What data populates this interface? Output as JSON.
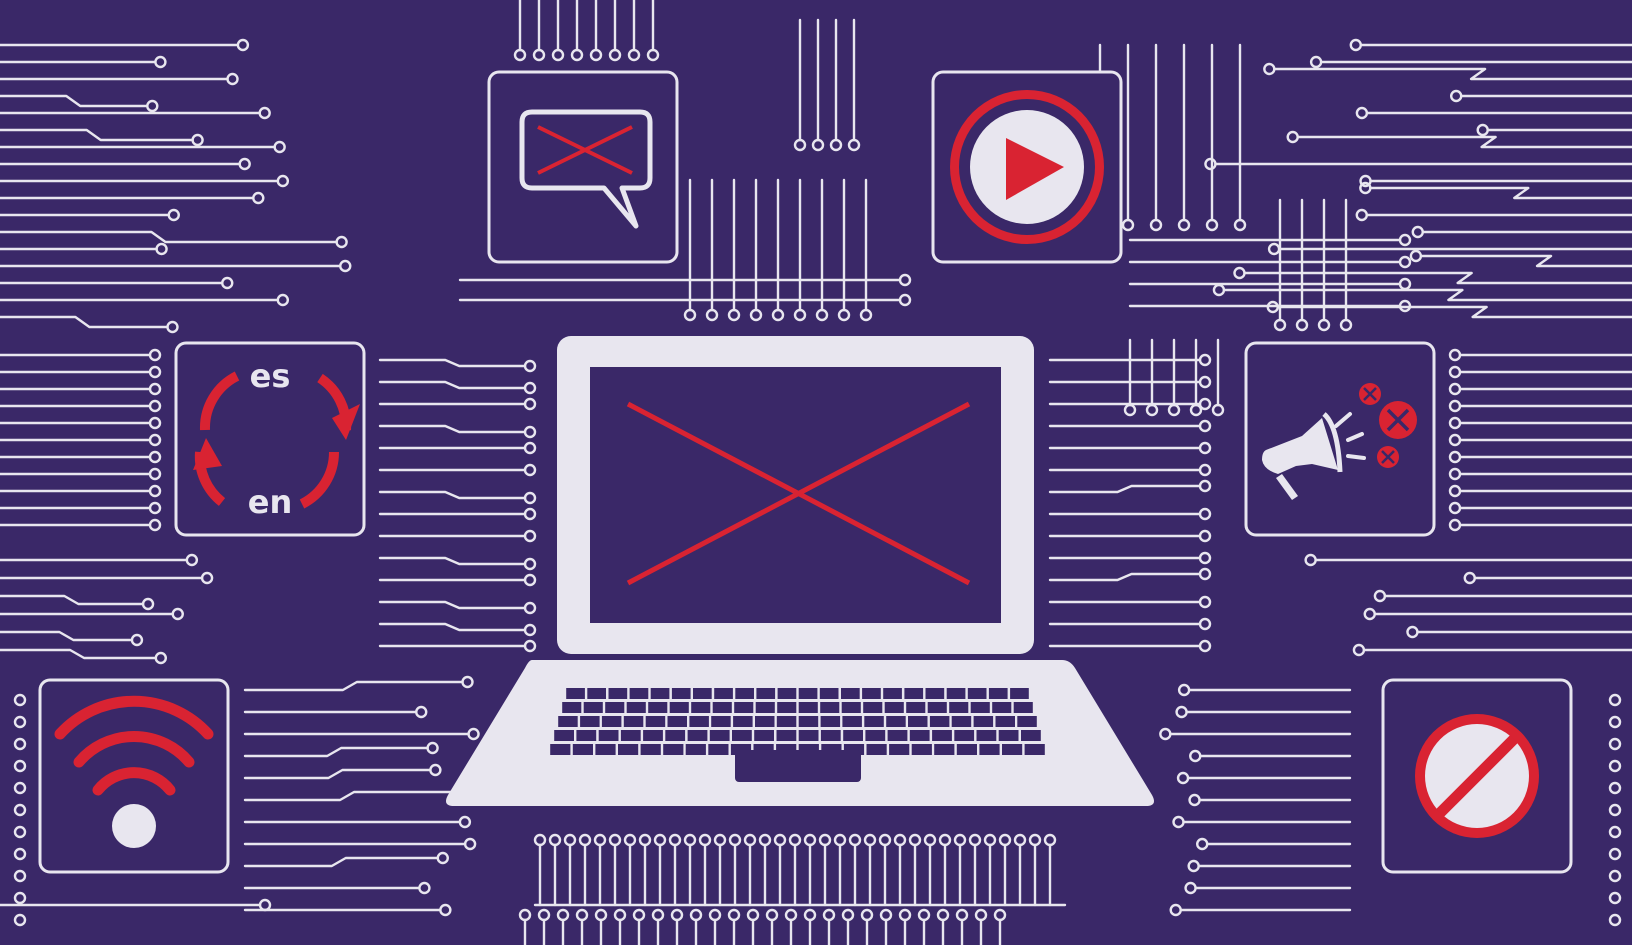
{
  "colors": {
    "background": "#3a2868",
    "circuit": "#e8e6ef",
    "accent": "#d92332"
  },
  "tiles": [
    {
      "icon": "blocked-chat-bubble-icon"
    },
    {
      "icon": "video-play-icon"
    },
    {
      "icon": "translate-cycle-icon"
    },
    {
      "icon": "megaphone-blocked-icon"
    },
    {
      "icon": "wifi-icon"
    },
    {
      "icon": "prohibited-sign-icon"
    }
  ],
  "laptop": {
    "icon": "laptop-blocked-screen-icon"
  },
  "translate": {
    "top_lang": "es",
    "bottom_lang": "en"
  }
}
